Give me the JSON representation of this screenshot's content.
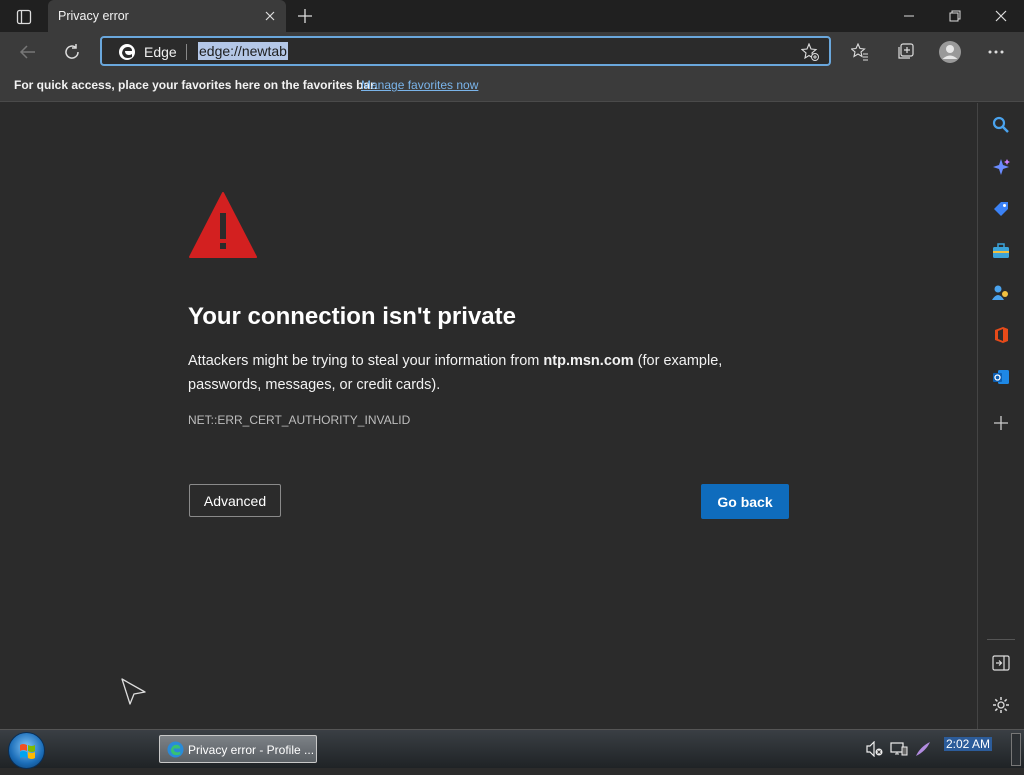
{
  "window": {
    "tab_title": "Privacy error"
  },
  "toolbar": {
    "site_label": "Edge",
    "url": "edge://newtab"
  },
  "favorites_bar": {
    "message": "For quick access, place your favorites here on the favorites bar.",
    "link": "Manage favorites now"
  },
  "error_page": {
    "heading": "Your connection isn't private",
    "desc_before": "Attackers might be trying to steal your information from ",
    "desc_host": "ntp.msn.com",
    "desc_after": " (for example, passwords, messages, or credit cards).",
    "error_code": "NET::ERR_CERT_AUTHORITY_INVALID",
    "advanced_label": "Advanced",
    "goback_label": "Go back"
  },
  "sidebar": {
    "icons": [
      "search-icon",
      "copilot-icon",
      "shopping-icon",
      "tools-icon",
      "people-icon",
      "office-icon",
      "outlook-icon",
      "add-icon",
      "hide-sidebar-icon",
      "settings-icon"
    ]
  },
  "taskbar": {
    "task_label": "Privacy error - Profile ...",
    "clock": "2:02 AM"
  },
  "colors": {
    "accent": "#0f6cbd",
    "warning": "#d32020",
    "link": "#7ab4ea"
  }
}
